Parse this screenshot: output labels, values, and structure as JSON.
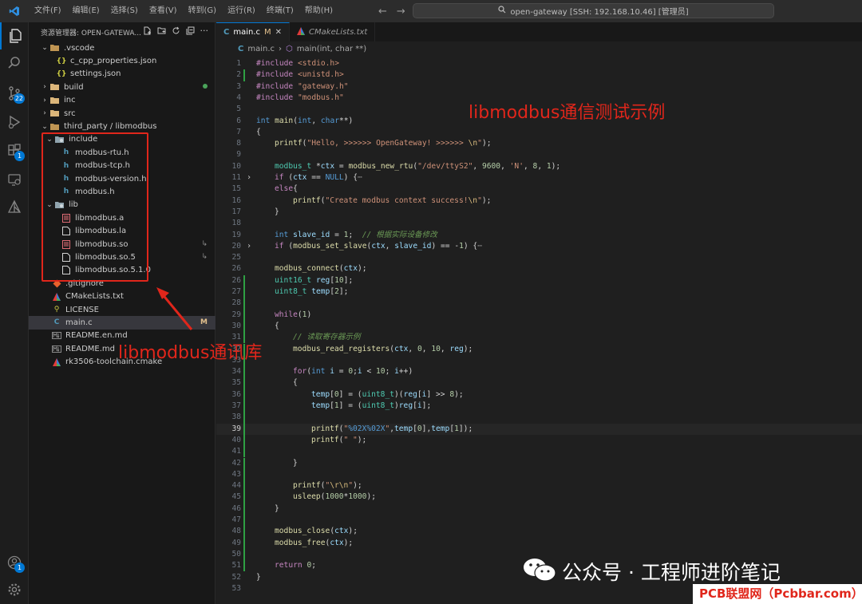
{
  "titlebar": {
    "menu": [
      "文件(F)",
      "编辑(E)",
      "选择(S)",
      "查看(V)",
      "转到(G)",
      "运行(R)",
      "终端(T)",
      "帮助(H)"
    ],
    "search_text": "open-gateway [SSH: 192.168.10.46] [管理员]"
  },
  "activity_bar": {
    "source_control_badge": "22",
    "extensions_badge": "1",
    "accounts_badge": "1"
  },
  "sidebar": {
    "title": "资源管理器: OPEN-GATEWA...",
    "tree": [
      {
        "label": ".vscode",
        "kind": "folder-open",
        "depth": 0
      },
      {
        "label": "c_cpp_properties.json",
        "kind": "json",
        "depth": 1
      },
      {
        "label": "settings.json",
        "kind": "json",
        "depth": 1
      },
      {
        "label": "build",
        "kind": "folder",
        "depth": 0,
        "git_dot": true
      },
      {
        "label": "inc",
        "kind": "folder",
        "depth": 0
      },
      {
        "label": "src",
        "kind": "folder",
        "depth": 0
      },
      {
        "label": "third_party / libmodbus",
        "kind": "folder-open",
        "depth": 0
      },
      {
        "label": "include",
        "kind": "folder-open-special",
        "depth": 1
      },
      {
        "label": "modbus-rtu.h",
        "kind": "header",
        "depth": 2
      },
      {
        "label": "modbus-tcp.h",
        "kind": "header",
        "depth": 2
      },
      {
        "label": "modbus-version.h",
        "kind": "header",
        "depth": 2
      },
      {
        "label": "modbus.h",
        "kind": "header",
        "depth": 2
      },
      {
        "label": "lib",
        "kind": "folder-open-special",
        "depth": 1
      },
      {
        "label": "libmodbus.a",
        "kind": "binary",
        "depth": 2
      },
      {
        "label": "libmodbus.la",
        "kind": "file",
        "depth": 2
      },
      {
        "label": "libmodbus.so",
        "kind": "binary",
        "depth": 2,
        "symlink": true
      },
      {
        "label": "libmodbus.so.5",
        "kind": "file",
        "depth": 2,
        "symlink": true
      },
      {
        "label": "libmodbus.so.5.1.0",
        "kind": "file",
        "depth": 2
      },
      {
        "label": ".gitignore",
        "kind": "git",
        "depth": 0
      },
      {
        "label": "CMakeLists.txt",
        "kind": "cmake",
        "depth": 0
      },
      {
        "label": "LICENSE",
        "kind": "license",
        "depth": 0
      },
      {
        "label": "main.c",
        "kind": "c",
        "depth": 0,
        "selected": true,
        "status": "M"
      },
      {
        "label": "README.en.md",
        "kind": "md",
        "depth": 0
      },
      {
        "label": "README.md",
        "kind": "md",
        "depth": 0
      },
      {
        "label": "rk3506-toolchain.cmake",
        "kind": "cmake",
        "depth": 0
      }
    ]
  },
  "tabs": [
    {
      "label": "main.c",
      "status": "M",
      "active": true
    },
    {
      "label": "CMakeLists.txt",
      "active": false
    }
  ],
  "breadcrumbs": {
    "file": "main.c",
    "symbol": "main(int, char **)"
  },
  "code": {
    "current_line": 39,
    "lines": [
      {
        "n": 1,
        "indent": 0,
        "html": "<span class=\"tk-kw\">#include</span> <span class=\"tk-str\">&lt;stdio.h&gt;</span>"
      },
      {
        "n": 2,
        "indent": 0,
        "html": "<span class=\"tk-kw\">#include</span> <span class=\"tk-str\">&lt;unistd.h&gt;</span>"
      },
      {
        "n": 3,
        "indent": 0,
        "html": "<span class=\"tk-kw\">#include</span> <span class=\"tk-str\">\"gateway.h\"</span>"
      },
      {
        "n": 4,
        "indent": 0,
        "html": "<span class=\"tk-kw\">#include</span> <span class=\"tk-str\">\"modbus.h\"</span>"
      },
      {
        "n": 5,
        "indent": 0,
        "html": ""
      },
      {
        "n": 6,
        "indent": 0,
        "html": "<span class=\"tk-ty\">int</span> <span class=\"tk-fn\">main</span>(<span class=\"tk-ty\">int</span>, <span class=\"tk-ty\">char</span>**)"
      },
      {
        "n": 7,
        "indent": 0,
        "html": "{"
      },
      {
        "n": 8,
        "indent": 1,
        "html": "<span class=\"tk-fn\">printf</span>(<span class=\"tk-str\">\"Hello, &gt;&gt;&gt;&gt;&gt;&gt; OpenGateway! &gt;&gt;&gt;&gt;&gt;&gt; </span><span class=\"tk-esc\">\\n</span><span class=\"tk-str\">\"</span>);"
      },
      {
        "n": 9,
        "indent": 0,
        "html": ""
      },
      {
        "n": 10,
        "indent": 1,
        "html": "<span class=\"tk-typ\">modbus_t</span> *<span class=\"tk-var\">ctx</span> = <span class=\"tk-fn\">modbus_new_rtu</span>(<span class=\"tk-str\">\"/dev/ttyS2\"</span>, <span class=\"tk-num\">9600</span>, <span class=\"tk-str\">'N'</span>, <span class=\"tk-num\">8</span>, <span class=\"tk-num\">1</span>);"
      },
      {
        "n": 11,
        "indent": 1,
        "fold": true,
        "html": "<span class=\"tk-kw\">if</span> (<span class=\"tk-var\">ctx</span> == <span class=\"tk-ty\">NULL</span>) {<span style=\"color:#8a8a8a\">⋯</span>"
      },
      {
        "n": 15,
        "indent": 1,
        "html": "<span class=\"tk-kw\">else</span>{"
      },
      {
        "n": 16,
        "indent": 2,
        "html": "<span class=\"tk-fn\">printf</span>(<span class=\"tk-str\">\"Create modbus context success!</span><span class=\"tk-esc\">\\n</span><span class=\"tk-str\">\"</span>);"
      },
      {
        "n": 17,
        "indent": 1,
        "html": "}"
      },
      {
        "n": 18,
        "indent": 0,
        "html": ""
      },
      {
        "n": 19,
        "indent": 1,
        "html": "<span class=\"tk-ty\">int</span> <span class=\"tk-var\">slave_id</span> = <span class=\"tk-num\">1</span>;  <span class=\"tk-cm\">// 根据实际设备修改</span>"
      },
      {
        "n": 20,
        "indent": 1,
        "fold": true,
        "html": "<span class=\"tk-kw\">if</span> (<span class=\"tk-fn\">modbus_set_slave</span>(<span class=\"tk-var\">ctx</span>, <span class=\"tk-var\">slave_id</span>) == -<span class=\"tk-num\">1</span>) {<span style=\"color:#8a8a8a\">⋯</span>"
      },
      {
        "n": 25,
        "indent": 0,
        "html": ""
      },
      {
        "n": 26,
        "indent": 1,
        "html": "<span class=\"tk-fn\">modbus_connect</span>(<span class=\"tk-var\">ctx</span>);"
      },
      {
        "n": 26,
        "indent": 1,
        "html": "<span class=\"tk-typ\">uint16_t</span> <span class=\"tk-var\">reg</span>[<span class=\"tk-num\">10</span>];"
      },
      {
        "n": 27,
        "indent": 1,
        "html": "<span class=\"tk-typ\">uint8_t</span> <span class=\"tk-var\">temp</span>[<span class=\"tk-num\">2</span>];"
      },
      {
        "n": 28,
        "indent": 0,
        "html": ""
      },
      {
        "n": 29,
        "indent": 1,
        "html": "<span class=\"tk-kw\">while</span>(<span class=\"tk-num\">1</span>)"
      },
      {
        "n": 30,
        "indent": 1,
        "html": "{"
      },
      {
        "n": 31,
        "indent": 2,
        "html": "<span class=\"tk-cm\">// 读取寄存器示例</span>"
      },
      {
        "n": 32,
        "indent": 2,
        "html": "<span class=\"tk-fn\">modbus_read_registers</span>(<span class=\"tk-var\">ctx</span>, <span class=\"tk-num\">0</span>, <span class=\"tk-num\">10</span>, <span class=\"tk-var\">reg</span>);"
      },
      {
        "n": 33,
        "indent": 0,
        "html": ""
      },
      {
        "n": 34,
        "indent": 2,
        "html": "<span class=\"tk-kw\">for</span>(<span class=\"tk-ty\">int</span> <span class=\"tk-var\">i</span> = <span class=\"tk-num\">0</span>;<span class=\"tk-var\">i</span> &lt; <span class=\"tk-num\">10</span>; <span class=\"tk-var\">i</span>++)"
      },
      {
        "n": 35,
        "indent": 2,
        "html": "{"
      },
      {
        "n": 36,
        "indent": 3,
        "html": "<span class=\"tk-var\">temp</span>[<span class=\"tk-num\">0</span>] = (<span class=\"tk-typ\">uint8_t</span>)(<span class=\"tk-var\">reg</span>[<span class=\"tk-var\">i</span>] &gt;&gt; <span class=\"tk-num\">8</span>);"
      },
      {
        "n": 37,
        "indent": 3,
        "html": "<span class=\"tk-var\">temp</span>[<span class=\"tk-num\">1</span>] = (<span class=\"tk-typ\">uint8_t</span>)<span class=\"tk-var\">reg</span>[<span class=\"tk-var\">i</span>];"
      },
      {
        "n": 38,
        "indent": 0,
        "html": ""
      },
      {
        "n": 39,
        "indent": 3,
        "html": "<span class=\"tk-fn\">printf</span>(<span class=\"tk-str\">\"</span><span class=\"tk-ty\">%02X%02X</span><span class=\"tk-str\">\"</span>,<span class=\"tk-var\">temp</span>[<span class=\"tk-num\">0</span>],<span class=\"tk-var\">temp</span>[<span class=\"tk-num\">1</span>]);"
      },
      {
        "n": 40,
        "indent": 3,
        "html": "<span class=\"tk-fn\">printf</span>(<span class=\"tk-str\">\" \"</span>);"
      },
      {
        "n": 41,
        "indent": 0,
        "html": ""
      },
      {
        "n": 42,
        "indent": 2,
        "html": "}"
      },
      {
        "n": 43,
        "indent": 0,
        "html": ""
      },
      {
        "n": 44,
        "indent": 2,
        "html": "<span class=\"tk-fn\">printf</span>(<span class=\"tk-str\">\"</span><span class=\"tk-esc\">\\r\\n</span><span class=\"tk-str\">\"</span>);"
      },
      {
        "n": 45,
        "indent": 2,
        "html": "<span class=\"tk-fn\">usleep</span>(<span class=\"tk-num\">1000</span>*<span class=\"tk-num\">1000</span>);"
      },
      {
        "n": 46,
        "indent": 1,
        "html": "}"
      },
      {
        "n": 47,
        "indent": 0,
        "html": ""
      },
      {
        "n": 48,
        "indent": 1,
        "html": "<span class=\"tk-fn\">modbus_close</span>(<span class=\"tk-var\">ctx</span>);"
      },
      {
        "n": 49,
        "indent": 1,
        "html": "<span class=\"tk-fn\">modbus_free</span>(<span class=\"tk-var\">ctx</span>);"
      },
      {
        "n": 50,
        "indent": 0,
        "html": ""
      },
      {
        "n": 51,
        "indent": 1,
        "html": "<span class=\"tk-kw\">return</span> <span class=\"tk-num\">0</span>;"
      },
      {
        "n": 52,
        "indent": 0,
        "html": "}"
      },
      {
        "n": 53,
        "indent": 0,
        "html": ""
      }
    ]
  },
  "annotations": {
    "code_title": "libmodbus通信测试示例",
    "library_label": "libmodbus通讯库"
  },
  "watermarks": {
    "wechat": "公众号 · 工程师进阶笔记",
    "site": "PCB联盟网（Pcbbar.com）"
  },
  "colors": {
    "accent": "#0078d4",
    "annotation_red": "#e0261b",
    "git_added": "#2ea043",
    "modified": "#e2c08d"
  }
}
